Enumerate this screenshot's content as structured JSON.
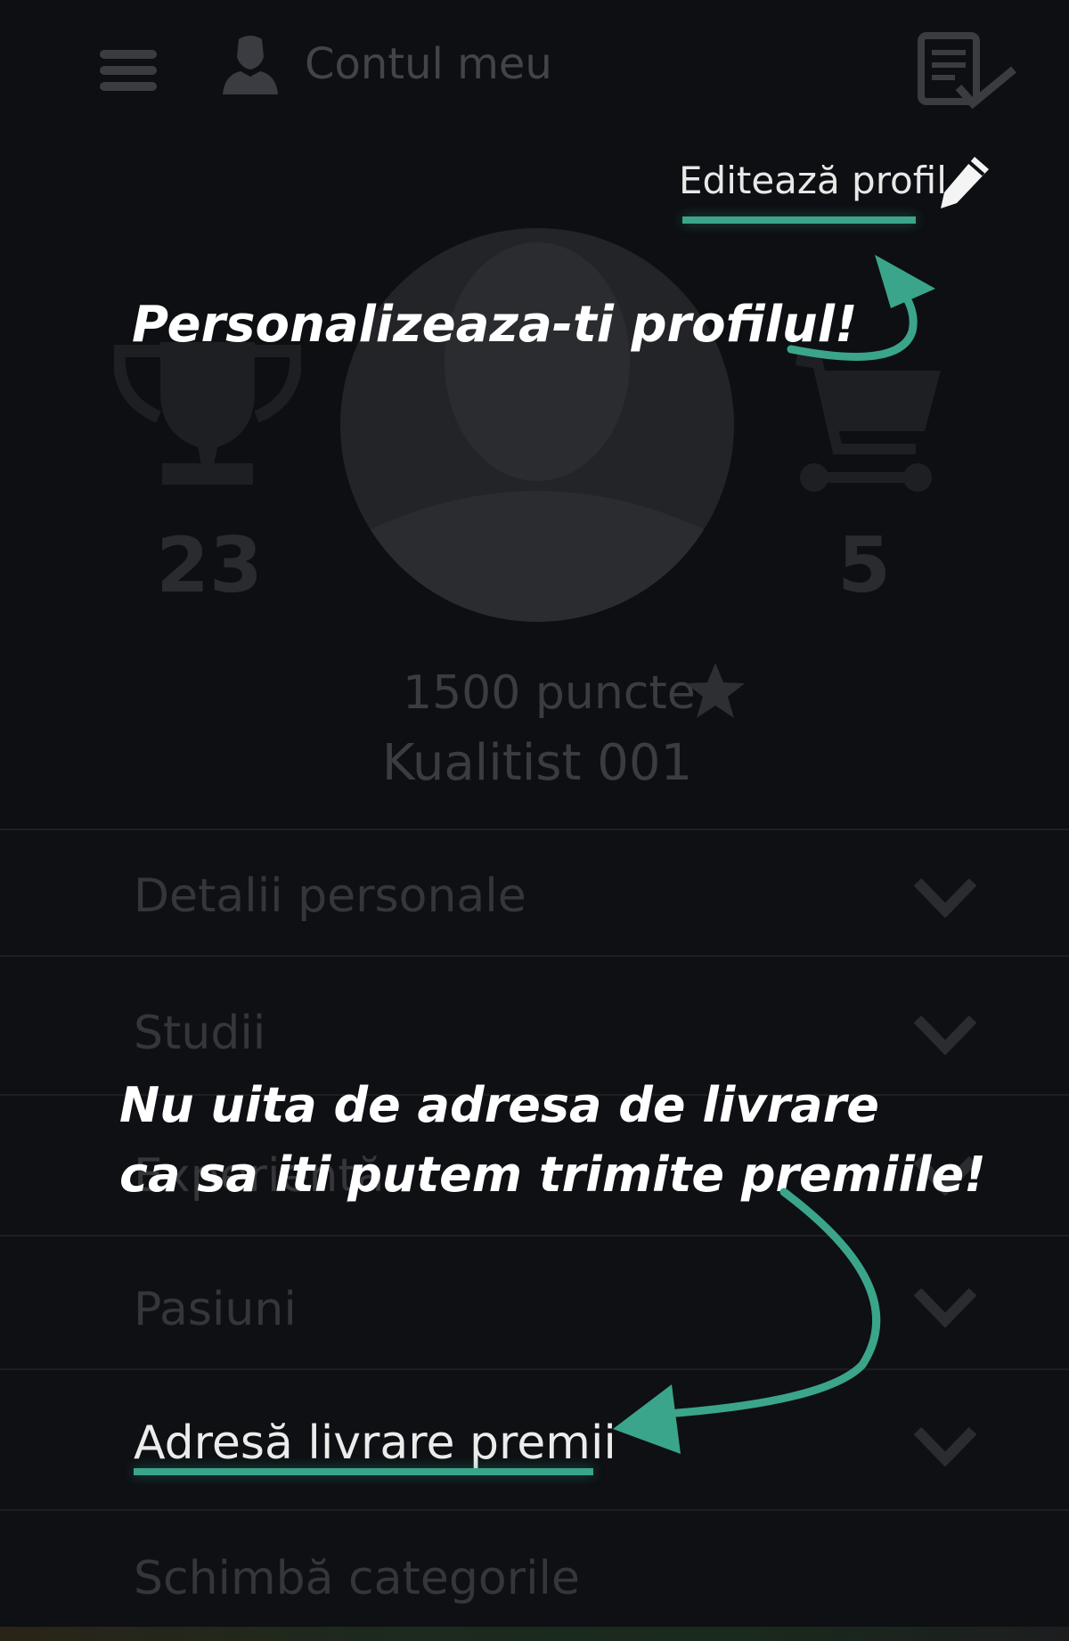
{
  "topbar": {
    "title": "Contul meu",
    "menu_icon": "hamburger-menu-icon",
    "user_icon": "user-icon",
    "tasks_icon": "checklist-icon"
  },
  "profile": {
    "edit_label": "Editează profil",
    "edit_icon": "pencil-icon",
    "trophies": "23",
    "cart_items": "5",
    "points": "1500 puncte",
    "username": "Kualitist 001"
  },
  "sections": [
    {
      "label": "Detalii personale"
    },
    {
      "label": "Studii"
    },
    {
      "label": "Experiență"
    },
    {
      "label": "Pasiuni"
    },
    {
      "label": "Adresă livrare premii"
    },
    {
      "label": "Schimbă categorile"
    }
  ],
  "annotations": {
    "profile_hint": "Personalizeaza-ti profilul!",
    "address_hint_line1": "Nu uita de adresa de livrare",
    "address_hint_line2": "ca sa iti putem trimite premiile!"
  },
  "colors": {
    "accent": "#3aa58a",
    "background": "#0d0f13"
  }
}
